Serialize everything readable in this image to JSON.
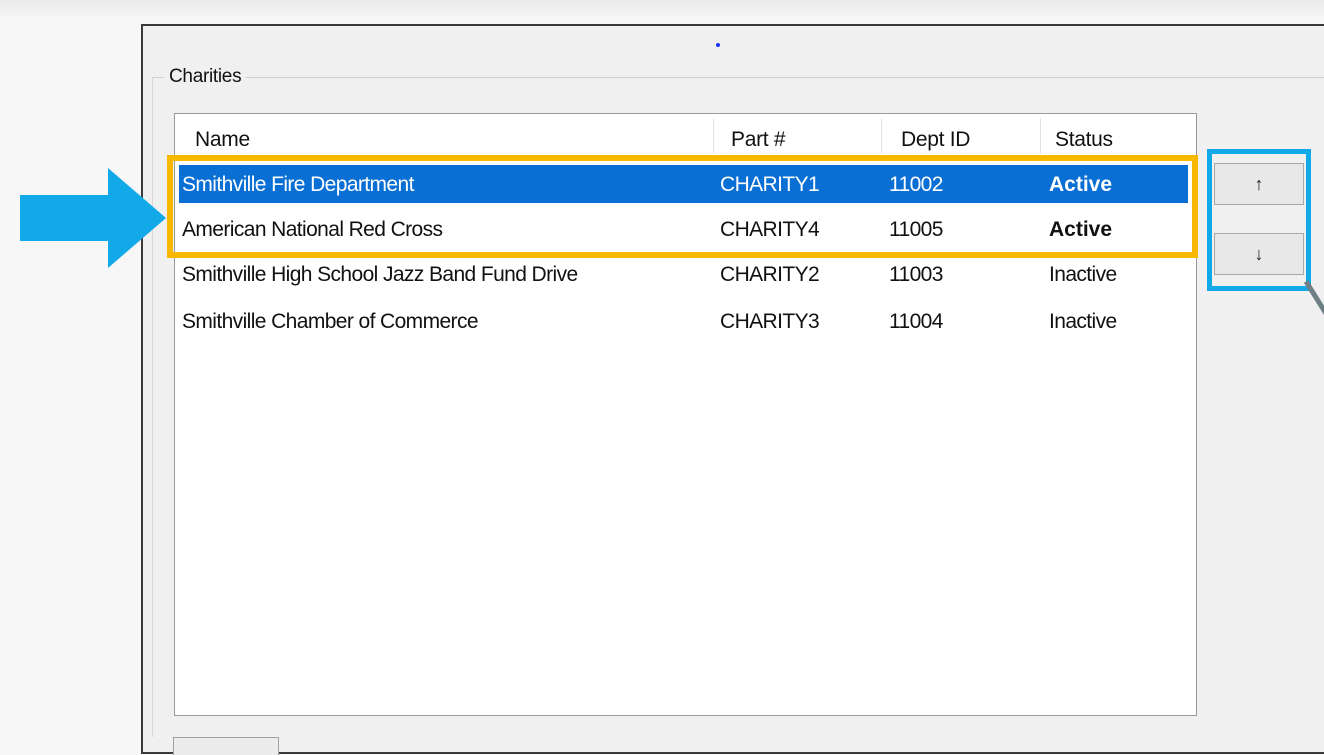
{
  "group": {
    "label": "Charities"
  },
  "columns": [
    "Name",
    "Part #",
    "Dept ID",
    "Status"
  ],
  "rows": [
    {
      "name": "Smithville Fire Department",
      "part": "CHARITY1",
      "dept": "11002",
      "status": "Active",
      "selected": true,
      "bold_status": true
    },
    {
      "name": "American National Red Cross",
      "part": "CHARITY4",
      "dept": "11005",
      "status": "Active",
      "selected": false,
      "bold_status": true
    },
    {
      "name": "Smithville High School Jazz Band Fund Drive",
      "part": "CHARITY2",
      "dept": "11003",
      "status": "Inactive",
      "selected": false,
      "bold_status": false
    },
    {
      "name": "Smithville Chamber of Commerce",
      "part": "CHARITY3",
      "dept": "11004",
      "status": "Inactive",
      "selected": false,
      "bold_status": false
    }
  ],
  "buttons": {
    "move_up": "↑",
    "move_down": "↓"
  },
  "colors": {
    "selection": "#0a6fd4",
    "highlight_box": "#f8b800",
    "callout": "#12a9e8"
  },
  "icons": {
    "move_up": "arrow-up-icon",
    "move_down": "arrow-down-icon",
    "callout": "right-arrow-icon"
  }
}
